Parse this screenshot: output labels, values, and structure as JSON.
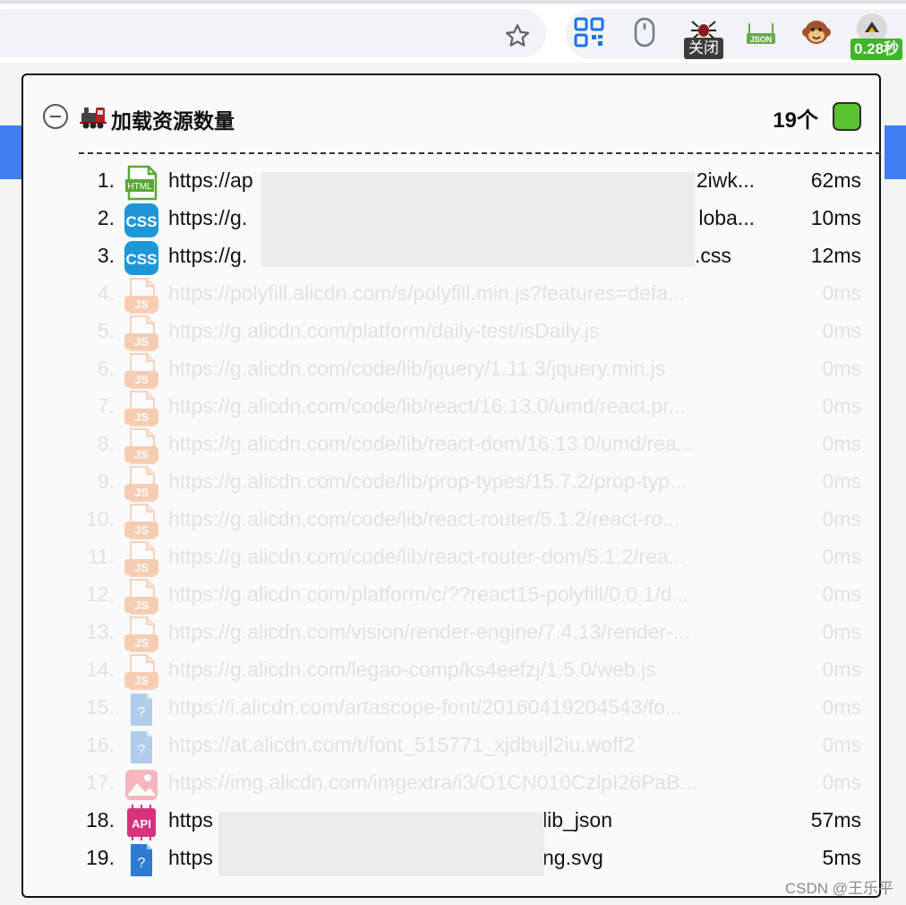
{
  "browser": {
    "bookmark_icon": "star-outline-icon",
    "extensions": [
      {
        "name": "qr-code-icon",
        "color": "#1a73e8"
      },
      {
        "name": "mouse-icon",
        "color": "#5f6368"
      },
      {
        "name": "spider-icon",
        "badge": "关闭"
      },
      {
        "name": "json-icon",
        "label": "JSON"
      },
      {
        "name": "monkey-icon"
      },
      {
        "name": "timer-icon",
        "badge": "0.28秒"
      }
    ]
  },
  "panel": {
    "title": "加载资源数量",
    "count": "19个",
    "status_color": "#5ac22f",
    "collapse_icon": "minus-circle-icon",
    "title_icon": "train-icon"
  },
  "resources": [
    {
      "index": "1.",
      "type": "html",
      "url": "https://ap",
      "url_tail": "2iwk...",
      "time": "62ms",
      "dim": false
    },
    {
      "index": "2.",
      "type": "css",
      "url": "https://g.",
      "url_tail": "loba...",
      "time": "10ms",
      "dim": false
    },
    {
      "index": "3.",
      "type": "css",
      "url": "https://g.",
      "url_tail": ".css",
      "time": "12ms",
      "dim": false
    },
    {
      "index": "4.",
      "type": "js",
      "url": "https://polyfill.alicdn.com/s/polyfill.min.js?features=defa...",
      "time": "0ms",
      "dim": true
    },
    {
      "index": "5.",
      "type": "js",
      "url": "https://g.alicdn.com/platform/daily-test/isDaily.js",
      "time": "0ms",
      "dim": true
    },
    {
      "index": "6.",
      "type": "js",
      "url": "https://g.alicdn.com/code/lib/jquery/1.11.3/jquery.min.js",
      "time": "0ms",
      "dim": true
    },
    {
      "index": "7.",
      "type": "js",
      "url": "https://g.alicdn.com/code/lib/react/16.13.0/umd/react.pr...",
      "time": "0ms",
      "dim": true
    },
    {
      "index": "8.",
      "type": "js",
      "url": "https://g.alicdn.com/code/lib/react-dom/16.13.0/umd/rea...",
      "time": "0ms",
      "dim": true
    },
    {
      "index": "9.",
      "type": "js",
      "url": "https://g.alicdn.com/code/lib/prop-types/15.7.2/prop-typ...",
      "time": "0ms",
      "dim": true
    },
    {
      "index": "10.",
      "type": "js",
      "url": "https://g.alicdn.com/code/lib/react-router/5.1.2/react-ro...",
      "time": "0ms",
      "dim": true
    },
    {
      "index": "11.",
      "type": "js",
      "url": "https://g.alicdn.com/code/lib/react-router-dom/5.1.2/rea...",
      "time": "0ms",
      "dim": true
    },
    {
      "index": "12.",
      "type": "js",
      "url": "https://g.alicdn.com/platform/c/??react15-polyfill/0.0.1/d...",
      "time": "0ms",
      "dim": true
    },
    {
      "index": "13.",
      "type": "js",
      "url": "https://g.alicdn.com/vision/render-engine/7.4.13/render-...",
      "time": "0ms",
      "dim": true
    },
    {
      "index": "14.",
      "type": "js",
      "url": "https://g.alicdn.com/legao-comp/ks4eefzj/1.5.0/web.js",
      "time": "0ms",
      "dim": true
    },
    {
      "index": "15.",
      "type": "unknown",
      "url": "https://i.alicdn.com/artascope-font/20160419204543/fo...",
      "time": "0ms",
      "dim": true
    },
    {
      "index": "16.",
      "type": "unknown",
      "url": "https://at.alicdn.com/t/font_515771_xjdbujl2iu.woff2",
      "time": "0ms",
      "dim": true
    },
    {
      "index": "17.",
      "type": "image",
      "url": "https://img.alicdn.com/imgextra/i3/O1CN010CzlpI26PaB...",
      "time": "0ms",
      "dim": true
    },
    {
      "index": "18.",
      "type": "api",
      "url": "https",
      "url_tail": "lib_json",
      "time": "57ms",
      "dim": false
    },
    {
      "index": "19.",
      "type": "unknown",
      "url": "https",
      "url_tail": "ng.svg",
      "time": "5ms",
      "dim": false
    }
  ],
  "icon_labels": {
    "html": "HTML",
    "css": "CSS",
    "js": "JS",
    "api": "API",
    "unknown": "?"
  },
  "watermark": "CSDN @王乐平"
}
